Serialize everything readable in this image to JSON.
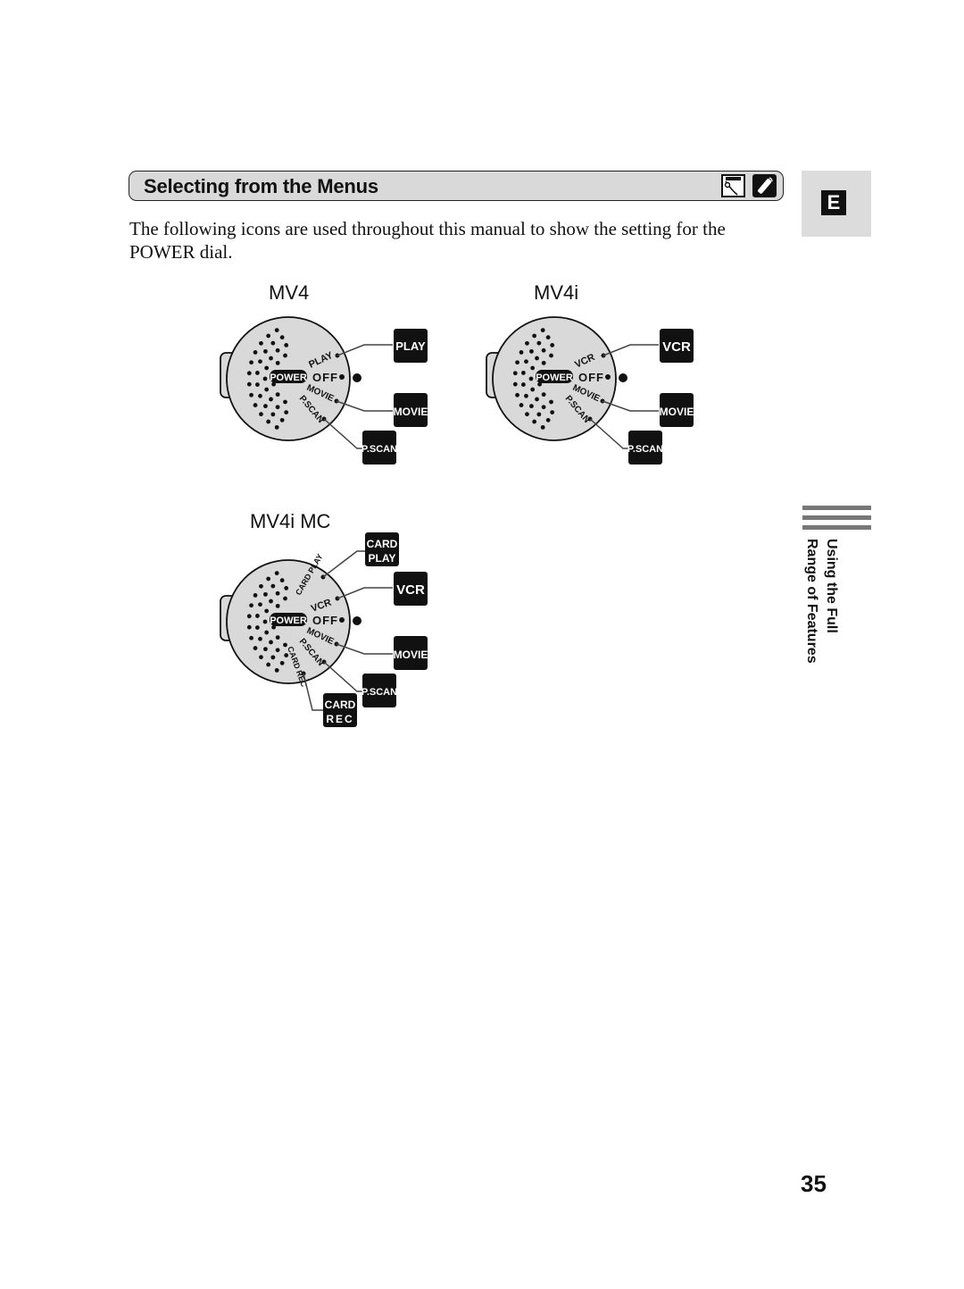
{
  "section": {
    "title": "Selecting from the Menus",
    "icons": [
      "camera-mode-icon",
      "remote-control-icon"
    ]
  },
  "language_tab": {
    "letter": "E"
  },
  "intro_text": "The following icons are used throughout this manual to show the setting for the POWER dial.",
  "models": [
    {
      "name": "MV4",
      "dial_center": "POWER",
      "dial_positions": [
        "PLAY",
        "OFF",
        "MOVIE",
        "P.SCAN"
      ],
      "icons": [
        "PLAY",
        "MOVIE",
        "P.SCAN"
      ]
    },
    {
      "name": "MV4i",
      "dial_center": "POWER",
      "dial_positions": [
        "VCR",
        "OFF",
        "MOVIE",
        "P.SCAN"
      ],
      "icons": [
        "VCR",
        "MOVIE",
        "P.SCAN"
      ]
    },
    {
      "name": "MV4i MC",
      "dial_center": "POWER",
      "dial_positions": [
        "CARD PLAY",
        "VCR",
        "OFF",
        "MOVIE",
        "P.SCAN",
        "CARD REC"
      ],
      "icons": [
        "CARD PLAY",
        "VCR",
        "MOVIE",
        "P.SCAN",
        "CARD REC"
      ]
    }
  ],
  "sidebar": {
    "line1": "Using the Full",
    "line2": "Range of Features"
  },
  "page_number": "35"
}
